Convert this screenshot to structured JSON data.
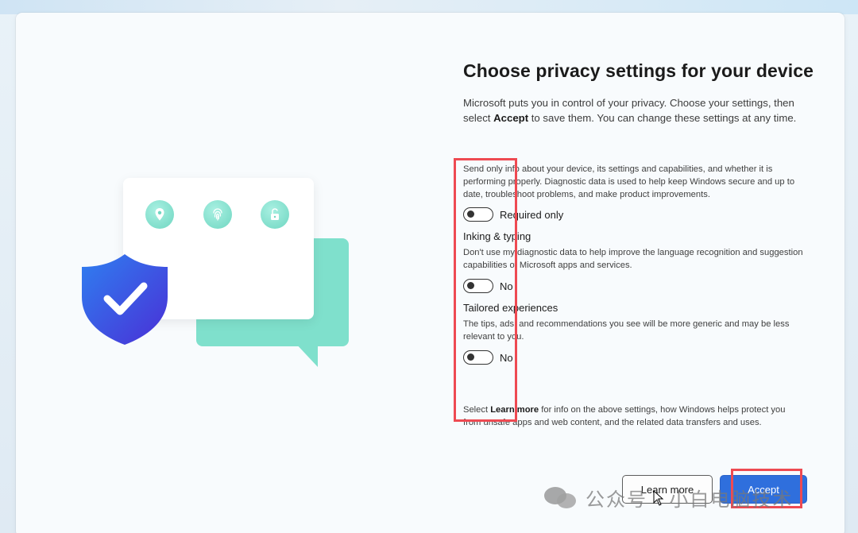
{
  "page": {
    "title": "Choose privacy settings for your device",
    "intro_prefix": "Microsoft puts you in control of your privacy. Choose your settings, then select ",
    "intro_bold": "Accept",
    "intro_suffix": " to save them. You can change these settings at any time."
  },
  "settings": [
    {
      "title": "",
      "description": "Send only info about your device, its settings and capabilities, and whether it is performing properly. Diagnostic data is used to help keep Windows secure and up to date, troubleshoot problems, and make product improvements.",
      "state_label": "Required only"
    },
    {
      "title": "Inking & typing",
      "description": "Don't use my diagnostic data to help improve the language recognition and suggestion capabilities of Microsoft apps and services.",
      "state_label": "No"
    },
    {
      "title": "Tailored experiences",
      "description": "The tips, ads, and recommendations you see will be more generic and may be less relevant to you.",
      "state_label": "No"
    }
  ],
  "footer": {
    "prefix": "Select ",
    "bold": "Learn more",
    "suffix": " for info on the above settings, how Windows helps protect you from unsafe apps and web content, and the related data transfers and uses."
  },
  "buttons": {
    "learn_more": "Learn more",
    "accept": "Accept"
  },
  "watermark": {
    "text": "公众号 · 小白电脑技术"
  },
  "illustration_icons": [
    "location-icon",
    "fingerprint-icon",
    "unlock-icon",
    "shield-check-icon"
  ],
  "colors": {
    "accent": "#2f6fdd",
    "teal": "#7fe0cc",
    "shield": "#3a4fe0",
    "annotation_red": "#ee4a52"
  }
}
